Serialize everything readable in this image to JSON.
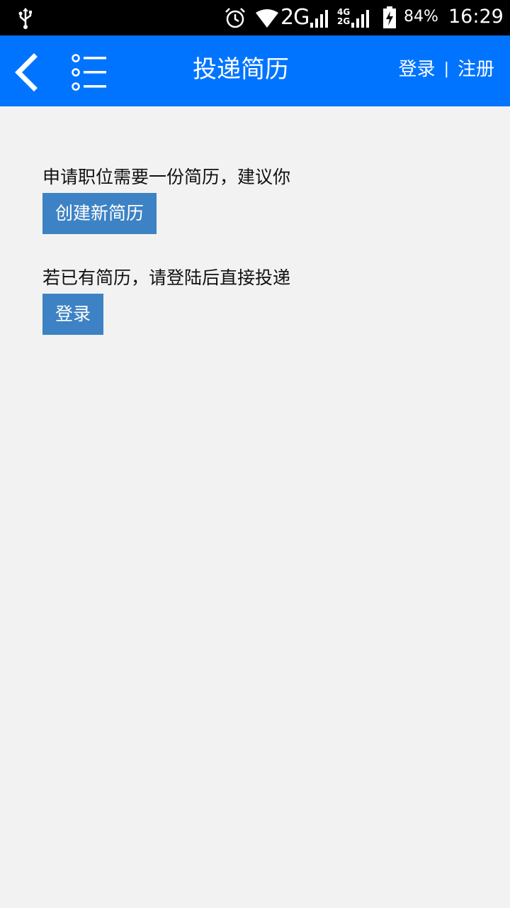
{
  "status_bar": {
    "network": "2G",
    "dual_top": "4G",
    "dual_bottom": "2G",
    "battery": "84%",
    "time": "16:29"
  },
  "app_bar": {
    "title": "投递简历",
    "login": "登录",
    "separator": "|",
    "register": "注册"
  },
  "content": {
    "prompt_create": "申请职位需要一份简历，建议你",
    "create_button": "创建新简历",
    "prompt_login": "若已有简历，请登陆后直接投递",
    "login_button": "登录"
  },
  "colors": {
    "app_bar": "#0174ff",
    "button": "#3d82c4",
    "background": "#f2f2f2"
  },
  "icons": [
    "usb-icon",
    "alarm-icon",
    "wifi-icon",
    "signal-icon",
    "battery-icon",
    "back-icon",
    "list-menu-icon"
  ]
}
